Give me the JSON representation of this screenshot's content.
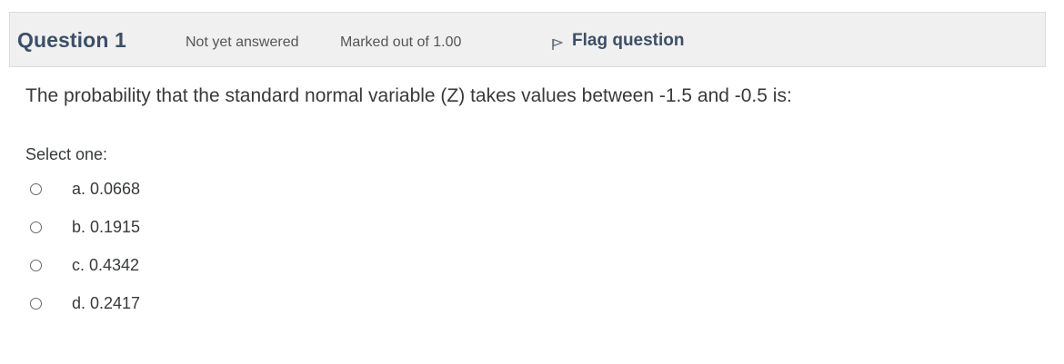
{
  "question": {
    "title": "Question 1",
    "state": "Not yet answered",
    "grade": "Marked out of 1.00",
    "flag_label": "Flag question",
    "text": "The probability that the standard normal variable (Z) takes values between -1.5 and -0.5 is:",
    "prompt": "Select one:",
    "options": [
      {
        "label": "a. 0.0668"
      },
      {
        "label": "b. 0.1915"
      },
      {
        "label": "c. 0.4342"
      },
      {
        "label": "d. 0.2417"
      }
    ]
  },
  "icons": {
    "flag": "flag-icon",
    "radio": "radio-unchecked-icon"
  },
  "colors": {
    "header_bg": "#f0f0f0",
    "title": "#3d4f66",
    "text": "#373a3c"
  }
}
